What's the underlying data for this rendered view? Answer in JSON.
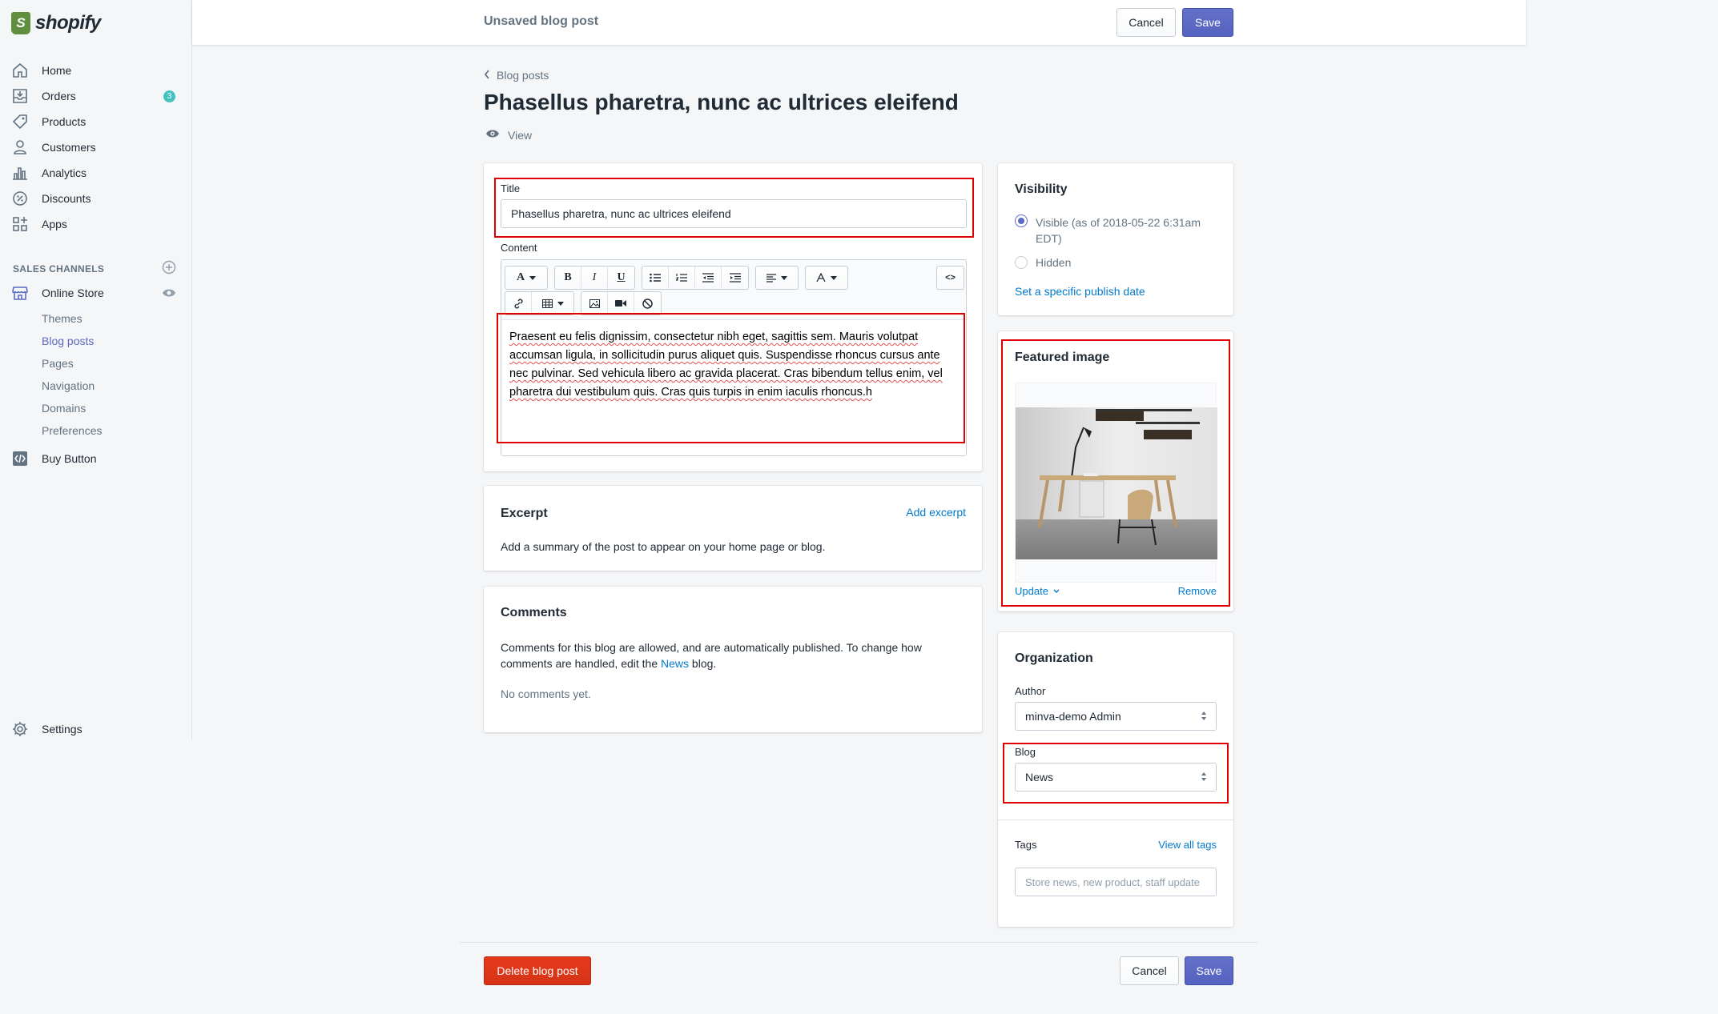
{
  "app": {
    "logo_text": "shopify"
  },
  "topbar": {
    "title": "Unsaved blog post",
    "cancel_label": "Cancel",
    "save_label": "Save"
  },
  "sidebar": {
    "items": [
      {
        "label": "Home",
        "icon": "home-icon"
      },
      {
        "label": "Orders",
        "icon": "orders-icon",
        "badge": "3"
      },
      {
        "label": "Products",
        "icon": "tag-icon"
      },
      {
        "label": "Customers",
        "icon": "person-icon"
      },
      {
        "label": "Analytics",
        "icon": "bar-chart-icon"
      },
      {
        "label": "Discounts",
        "icon": "discount-icon"
      },
      {
        "label": "Apps",
        "icon": "apps-icon"
      }
    ],
    "sales_channels_heading": "SALES CHANNELS",
    "online_store": {
      "label": "Online Store"
    },
    "sub_items": [
      {
        "label": "Themes"
      },
      {
        "label": "Blog posts"
      },
      {
        "label": "Pages"
      },
      {
        "label": "Navigation"
      },
      {
        "label": "Domains"
      },
      {
        "label": "Preferences"
      }
    ],
    "buy_button": {
      "label": "Buy Button"
    },
    "settings": {
      "label": "Settings"
    }
  },
  "page": {
    "breadcrumb": "Blog posts",
    "title": "Phasellus pharetra, nunc ac ultrices eleifend",
    "view_label": "View"
  },
  "post_card": {
    "title_label": "Title",
    "title_value": "Phasellus pharetra, nunc ac ultrices eleifend",
    "content_label": "Content",
    "content_text": "Praesent eu felis dignissim, consectetur nibh eget, sagittis sem. Mauris volutpat accumsan ligula, in sollicitudin purus aliquet quis. Suspendisse rhoncus cursus ante nec pulvinar. Sed vehicula libero ac gravida placerat. Cras bibendum tellus enim, vel pharetra dui vestibulum quis. Cras quis turpis in enim iaculis rhoncus.h",
    "toolbar": {
      "font_glyph": "A",
      "bold": "B",
      "italic": "I",
      "underline": "U",
      "code_glyph": "<>"
    }
  },
  "excerpt": {
    "heading": "Excerpt",
    "add_link": "Add excerpt",
    "description": "Add a summary of the post to appear on your home page or blog."
  },
  "comments": {
    "heading": "Comments",
    "text_before": "Comments for this blog are allowed, and are automatically published. To change how comments are handled, edit the ",
    "blog_link": "News",
    "text_after": " blog.",
    "empty": "No comments yet."
  },
  "visibility": {
    "heading": "Visibility",
    "visible_label": "Visible (as of 2018-05-22 6:31am EDT)",
    "hidden_label": "Hidden",
    "publish_date_link": "Set a specific publish date",
    "selected": "visible"
  },
  "featured_image": {
    "heading": "Featured image",
    "update_label": "Update",
    "remove_label": "Remove"
  },
  "organization": {
    "heading": "Organization",
    "author_label": "Author",
    "author_value": "minva-demo Admin",
    "blog_label": "Blog",
    "blog_value": "News",
    "tags_label": "Tags",
    "view_tags_link": "View all tags",
    "tags_placeholder": "Store news, new product, staff update"
  },
  "footer": {
    "delete_label": "Delete blog post",
    "cancel_label": "Cancel",
    "save_label": "Save"
  },
  "colors": {
    "primary": "#5c6ac4",
    "danger": "#de3618",
    "link": "#007ace",
    "badge": "#47c1bf",
    "highlight": "#e00000"
  }
}
